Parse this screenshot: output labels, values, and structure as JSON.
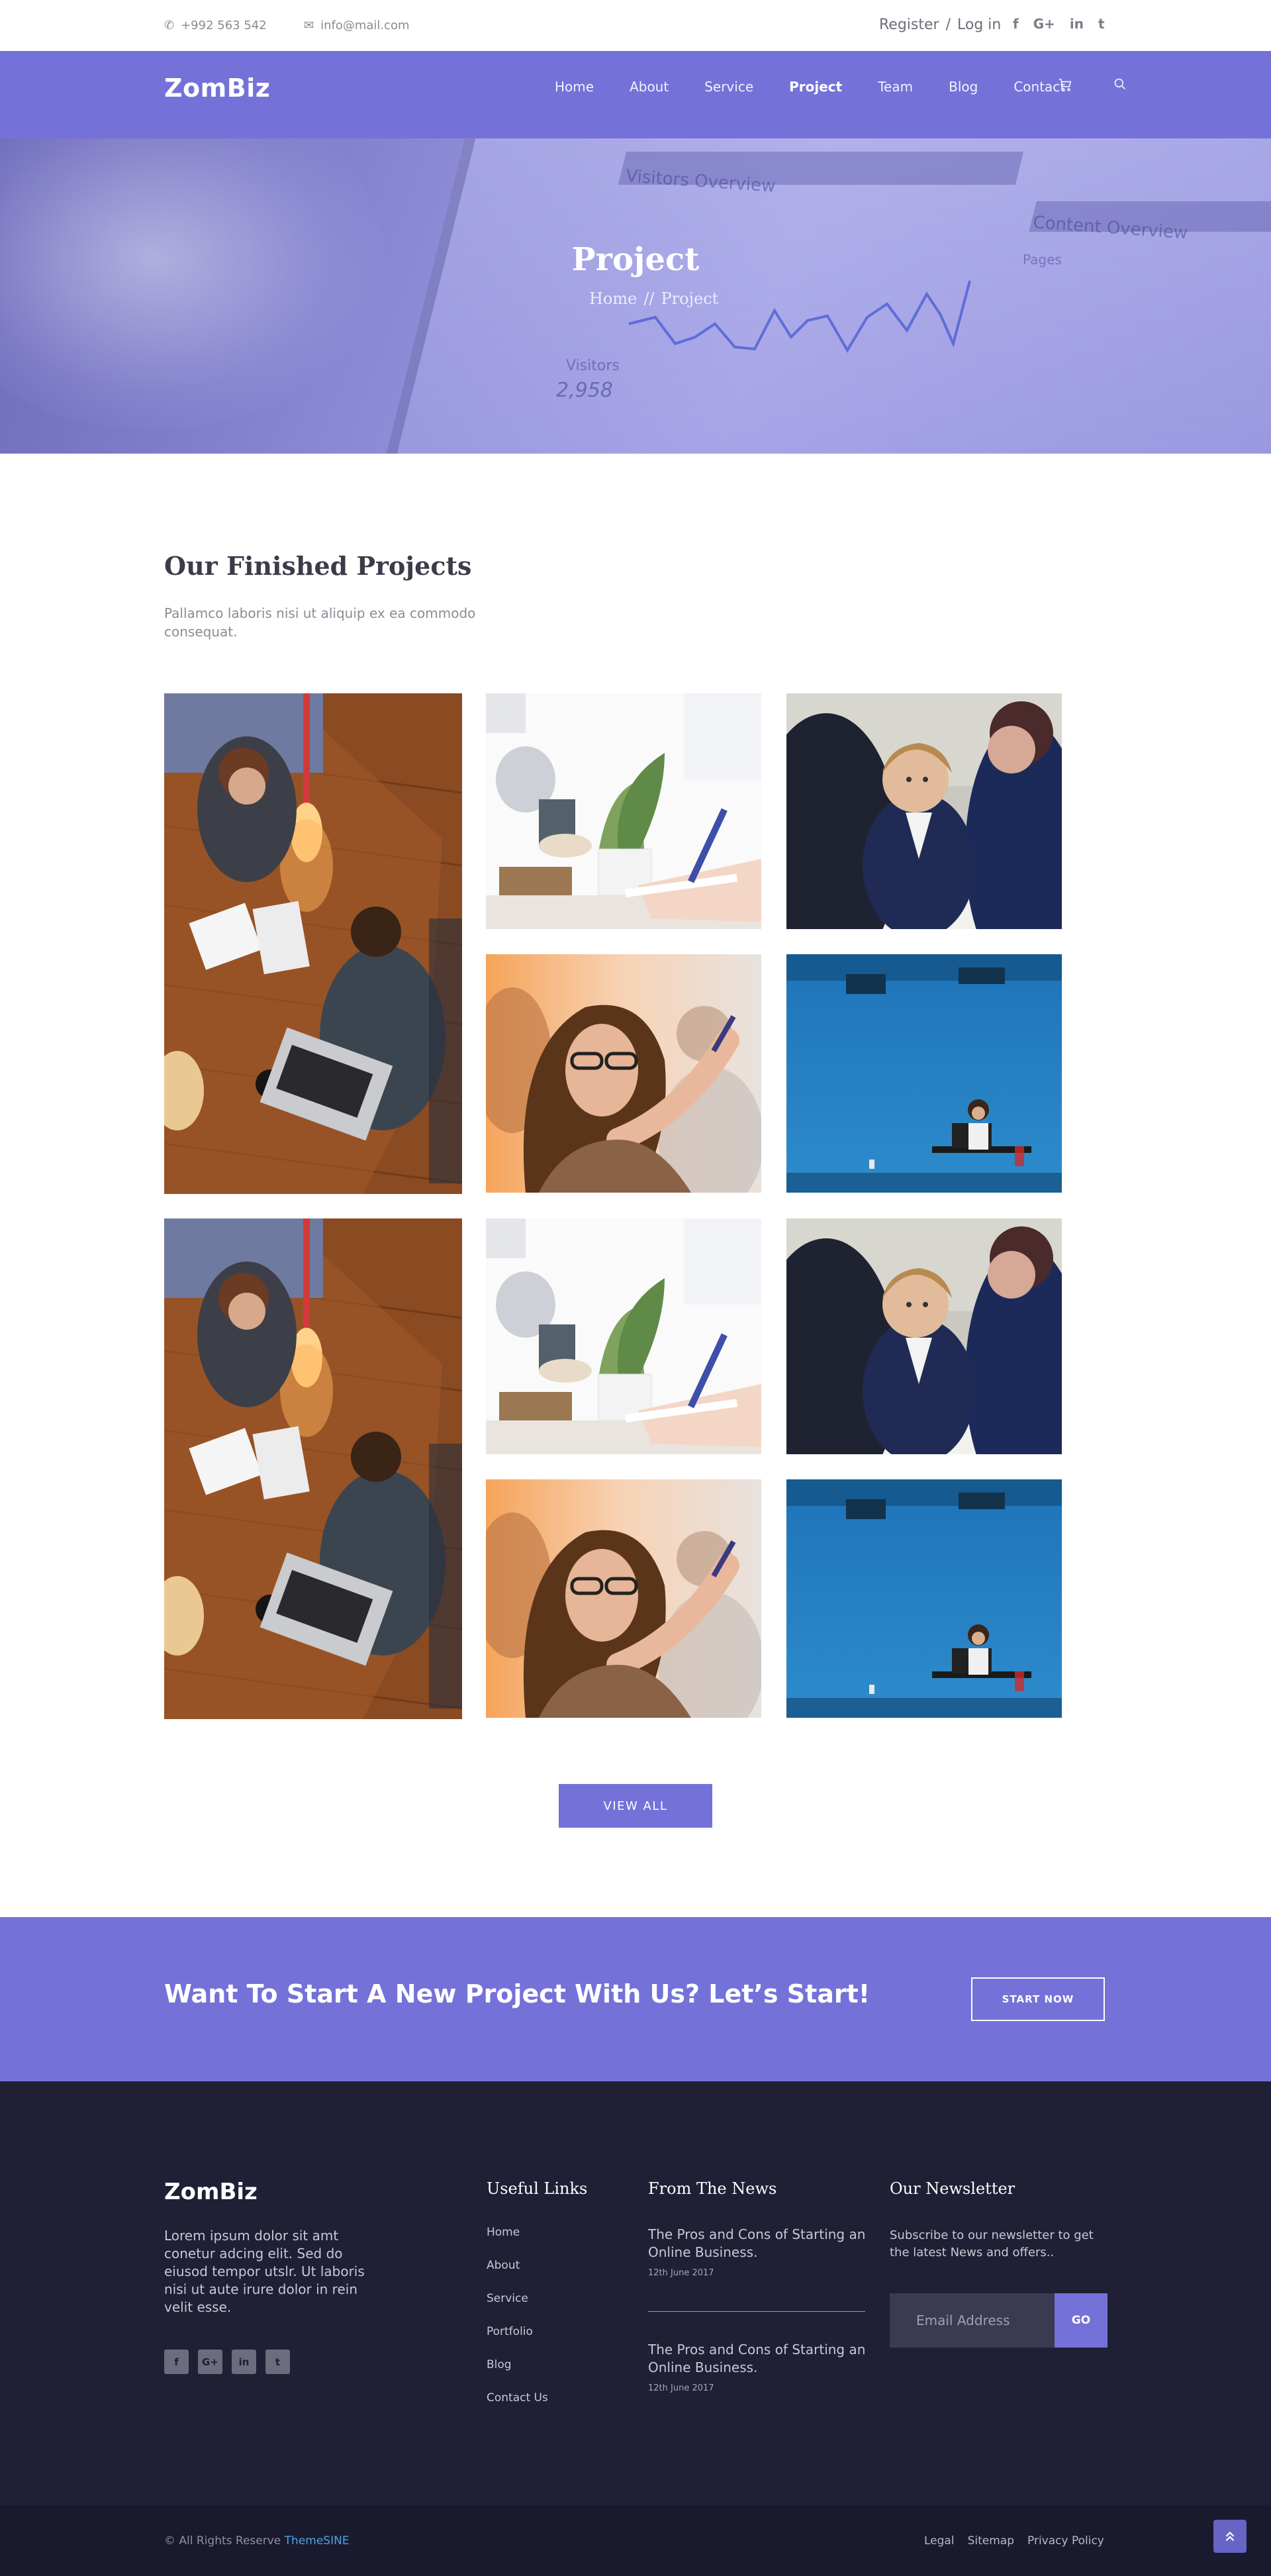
{
  "topbar": {
    "phone": "+992 563 542",
    "email": "info@mail.com",
    "register": "Register",
    "separator": "/",
    "login": "Log in",
    "social": [
      "f",
      "G+",
      "in",
      "t"
    ]
  },
  "nav": {
    "brand": "ZomBiz",
    "items": [
      "Home",
      "About",
      "Service",
      "Project",
      "Team",
      "Blog",
      "Contact"
    ],
    "active": "Project"
  },
  "hero": {
    "title": "Project",
    "breadcrumb_home": "Home",
    "breadcrumb_sep": "//",
    "breadcrumb_current": "Project",
    "tablet_text": [
      "Visitors Overview",
      "Content Overview",
      "Visitors",
      "2,958",
      "Pages"
    ]
  },
  "projects": {
    "title": "Our Finished Projects",
    "subtitle": "Pallamco laboris nisi ut aliquip ex ea commodo consequat.",
    "view_all": "VIEW ALL"
  },
  "cta": {
    "text": "Want To Start A New Project With Us? Let’s Start!",
    "button": "START NOW"
  },
  "footer": {
    "brand": "ZomBiz",
    "about": "Lorem ipsum dolor sit amt conetur adcing elit. Sed do eiusod tempor utslr. Ut laboris nisi ut aute irure dolor in rein velit esse.",
    "social": [
      "f",
      "G+",
      "in",
      "t"
    ],
    "useful_links_title": "Useful Links",
    "useful_links": [
      "Home",
      "About",
      "Service",
      "Portfolio",
      "Blog",
      "Contact Us"
    ],
    "news_title": "From The News",
    "news": [
      {
        "title": "The Pros and Cons of Starting an Online Business.",
        "date": "12th June 2017"
      },
      {
        "title": "The Pros and Cons of Starting an Online Business.",
        "date": "12th June 2017"
      }
    ],
    "newsletter_title": "Our Newsletter",
    "newsletter_text": "Subscribe to our newsletter to get the latest News and offers..",
    "email_placeholder": "Email Address",
    "go": "GO"
  },
  "bottombar": {
    "copyright": "© All Rights Reserve",
    "copyright_brand": "ThemeSINE",
    "legal": [
      "Legal",
      "Sitemap",
      "Privacy Policy"
    ]
  },
  "colors": {
    "accent": "#7472d8",
    "footer_bg": "#1f1f35",
    "bottom_bg": "#1a1a2e"
  }
}
